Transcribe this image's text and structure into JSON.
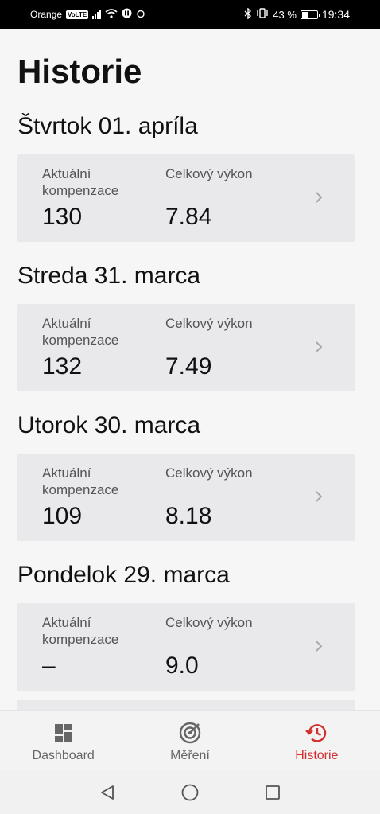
{
  "status_bar": {
    "carrier": "Orange",
    "volte": "VoLTE",
    "battery_percent": "43 %",
    "battery_level": 0.43,
    "time": "19:34"
  },
  "page": {
    "title": "Historie"
  },
  "days": [
    {
      "title": "Štvrtok 01. apríla",
      "label1": "Aktuální kompenzace",
      "value1": "130",
      "label2": "Celkový výkon",
      "value2": "7.84"
    },
    {
      "title": "Streda 31. marca",
      "label1": "Aktuální kompenzace",
      "value1": "132",
      "label2": "Celkový výkon",
      "value2": "7.49"
    },
    {
      "title": "Utorok 30. marca",
      "label1": "Aktuální kompenzace",
      "value1": "109",
      "label2": "Celkový výkon",
      "value2": "8.18"
    },
    {
      "title": "Pondelok 29. marca",
      "label1": "Aktuální kompenzace",
      "value1": "–",
      "label2": "Celkový výkon",
      "value2": "9.0"
    }
  ],
  "nav": {
    "items": [
      {
        "label": "Dashboard",
        "icon": "dashboard-icon",
        "active": false
      },
      {
        "label": "Měření",
        "icon": "measure-icon",
        "active": false
      },
      {
        "label": "Historie",
        "icon": "history-icon",
        "active": true
      }
    ],
    "active_color": "#d32f2f"
  },
  "system_nav": {
    "buttons": [
      "back-icon",
      "home-icon",
      "recents-icon"
    ]
  }
}
